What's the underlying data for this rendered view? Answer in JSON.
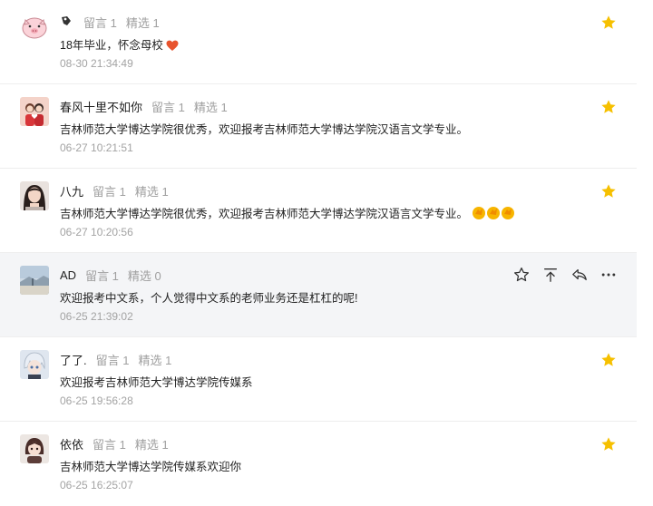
{
  "comments": [
    {
      "nickname": "",
      "messages_label": "留言 1",
      "featured_label": "精选 1",
      "text": "18年毕业，怀念母校",
      "time": "08-30 21:34:49",
      "avatar": "pig-avatar",
      "starred": true
    },
    {
      "nickname": "春风十里不如你",
      "messages_label": "留言 1",
      "featured_label": "精选 1",
      "text": "吉林师范大学博达学院很优秀，欢迎报考吉林师范大学博达学院汉语言文学专业。",
      "time": "06-27 10:21:51",
      "avatar": "couple-avatar",
      "starred": true
    },
    {
      "nickname": "八九",
      "messages_label": "留言 1",
      "featured_label": "精选 1",
      "text": "吉林师范大学博达学院很优秀，欢迎报考吉林师范大学博达学院汉语言文学专业。",
      "time": "06-27 10:20:56",
      "avatar": "girl-avatar",
      "starred": true
    },
    {
      "nickname": "AD",
      "messages_label": "留言 1",
      "featured_label": "精选 0",
      "text": "欢迎报考中文系，个人觉得中文系的老师业务还是杠杠的呢!",
      "time": "06-25 21:39:02",
      "avatar": "landscape-avatar",
      "starred": false
    },
    {
      "nickname": "了了.",
      "messages_label": "留言 1",
      "featured_label": "精选 1",
      "text": "欢迎报考吉林师范大学博达学院传媒系",
      "time": "06-25 19:56:28",
      "avatar": "anime-avatar",
      "starred": true
    },
    {
      "nickname": "依依",
      "messages_label": "留言 1",
      "featured_label": "精选 1",
      "text": "吉林师范大学博达学院传媒系欢迎你",
      "time": "06-25 16:25:07",
      "avatar": "doll-avatar",
      "starred": true
    }
  ],
  "colors": {
    "star": "#f6c000",
    "meta": "#a0a0a0",
    "hover_bg": "#f4f5f7",
    "heart": "#e8542e"
  },
  "icons": {
    "star": "star-icon",
    "star_outline": "star-outline-icon",
    "pin_top": "pin-top-icon",
    "reply": "reply-icon",
    "more": "more-icon"
  }
}
